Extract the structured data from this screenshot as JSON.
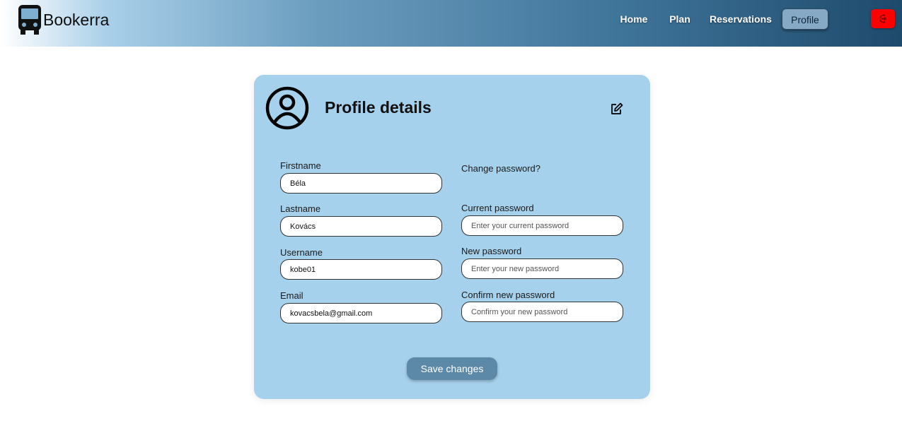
{
  "app": {
    "brand": "Bookerra"
  },
  "nav": {
    "items": [
      {
        "label": "Home"
      },
      {
        "label": "Plan"
      },
      {
        "label": "Reservations"
      },
      {
        "label": "Profile",
        "active": true
      }
    ],
    "logout_icon": "exit-icon",
    "logout_color": "#ff0000"
  },
  "profile": {
    "title": "Profile details",
    "avatar_icon": "user-circle-icon",
    "edit_icon": "edit-icon",
    "fields": {
      "firstname": {
        "label": "Firstname",
        "value": "Béla"
      },
      "lastname": {
        "label": "Lastname",
        "value": "Kovács"
      },
      "username": {
        "label": "Username",
        "value": "kobe01"
      },
      "email": {
        "label": "Email",
        "value": "kovacsbela@gmail.com"
      }
    },
    "password": {
      "heading": "Change password?",
      "current": {
        "label": "Current password",
        "placeholder": "Enter your current password"
      },
      "new": {
        "label": "New password",
        "placeholder": "Enter your new password"
      },
      "confirm": {
        "label": "Confirm new password",
        "placeholder": "Confirm your new password"
      }
    },
    "save_label": "Save changes"
  },
  "colors": {
    "card_bg": "#a6d1ec",
    "save_button": "#5d89a8",
    "nav_dark": "#1e4a6c"
  }
}
